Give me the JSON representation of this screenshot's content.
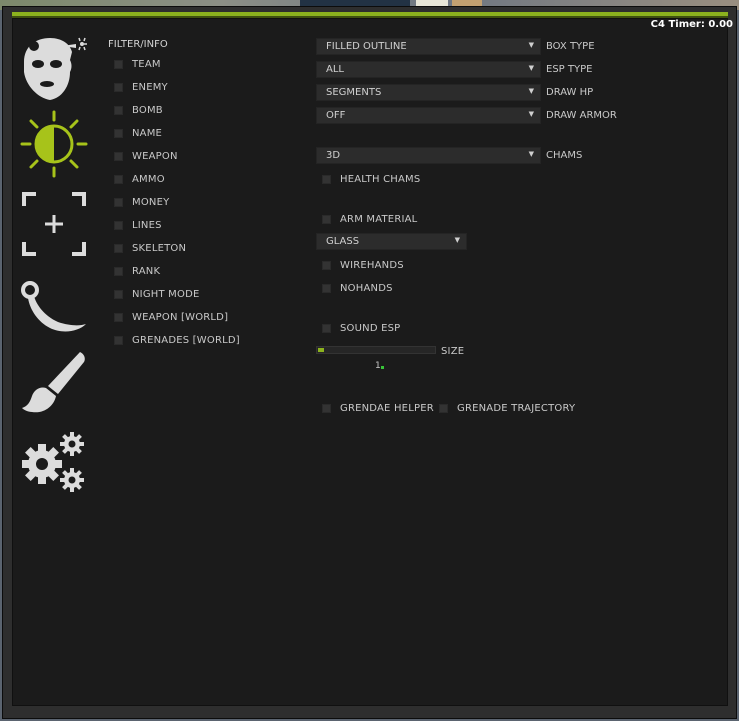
{
  "overlay": {
    "c4_timer": "C4 Timer: 0.00"
  },
  "colors": {
    "accent": "#8cb21e",
    "panel": "#1b1b1b",
    "control": "#2c2c2c",
    "text": "#c9c9c9"
  },
  "sidebar": {
    "tabs": [
      {
        "icon": "masked-head-icon",
        "active": false
      },
      {
        "icon": "half-sun-icon",
        "active": true
      },
      {
        "icon": "crosshair-icon",
        "active": false
      },
      {
        "icon": "karambit-knife-icon",
        "active": false
      },
      {
        "icon": "paint-brush-icon",
        "active": false
      },
      {
        "icon": "gears-icon",
        "active": false
      }
    ]
  },
  "filter": {
    "title": "FILTER/INFO",
    "items": [
      {
        "label": "TEAM",
        "checked": false
      },
      {
        "label": "ENEMY",
        "checked": false
      },
      {
        "label": "BOMB",
        "checked": false
      },
      {
        "label": "NAME",
        "checked": false
      },
      {
        "label": "WEAPON",
        "checked": false
      },
      {
        "label": "AMMO",
        "checked": false
      },
      {
        "label": "MONEY",
        "checked": false
      },
      {
        "label": "LINES",
        "checked": false
      },
      {
        "label": "SKELETON",
        "checked": false
      },
      {
        "label": "RANK",
        "checked": false
      },
      {
        "label": "NIGHT MODE",
        "checked": false
      },
      {
        "label": "WEAPON [WORLD]",
        "checked": false
      },
      {
        "label": "GRENADES [WORLD]",
        "checked": false
      }
    ]
  },
  "esp": {
    "box_type": {
      "value": "FILLED OUTLINE",
      "label": "BOX TYPE"
    },
    "esp_type": {
      "value": "ALL",
      "label": "ESP TYPE"
    },
    "draw_hp": {
      "value": "SEGMENTS",
      "label": "DRAW HP"
    },
    "draw_armor": {
      "value": "OFF",
      "label": "DRAW ARMOR"
    },
    "chams": {
      "value": "3D",
      "label": "CHAMS"
    },
    "health_chams": {
      "label": "HEALTH CHAMS",
      "checked": false
    },
    "arm_material": {
      "label": "ARM MATERIAL",
      "checked": false
    },
    "material": {
      "value": "GLASS"
    },
    "wirehands": {
      "label": "WIREHANDS",
      "checked": false
    },
    "nohands": {
      "label": "NOHANDS",
      "checked": false
    },
    "sound_esp": {
      "label": "SOUND ESP",
      "checked": false
    },
    "size": {
      "label": "SIZE",
      "value": "1.",
      "fraction": 0.05
    },
    "grenade_helper": {
      "label": "GRENDAE HELPER",
      "checked": false
    },
    "grenade_trajectory": {
      "label": "GRENADE TRAJECTORY",
      "checked": false
    }
  }
}
